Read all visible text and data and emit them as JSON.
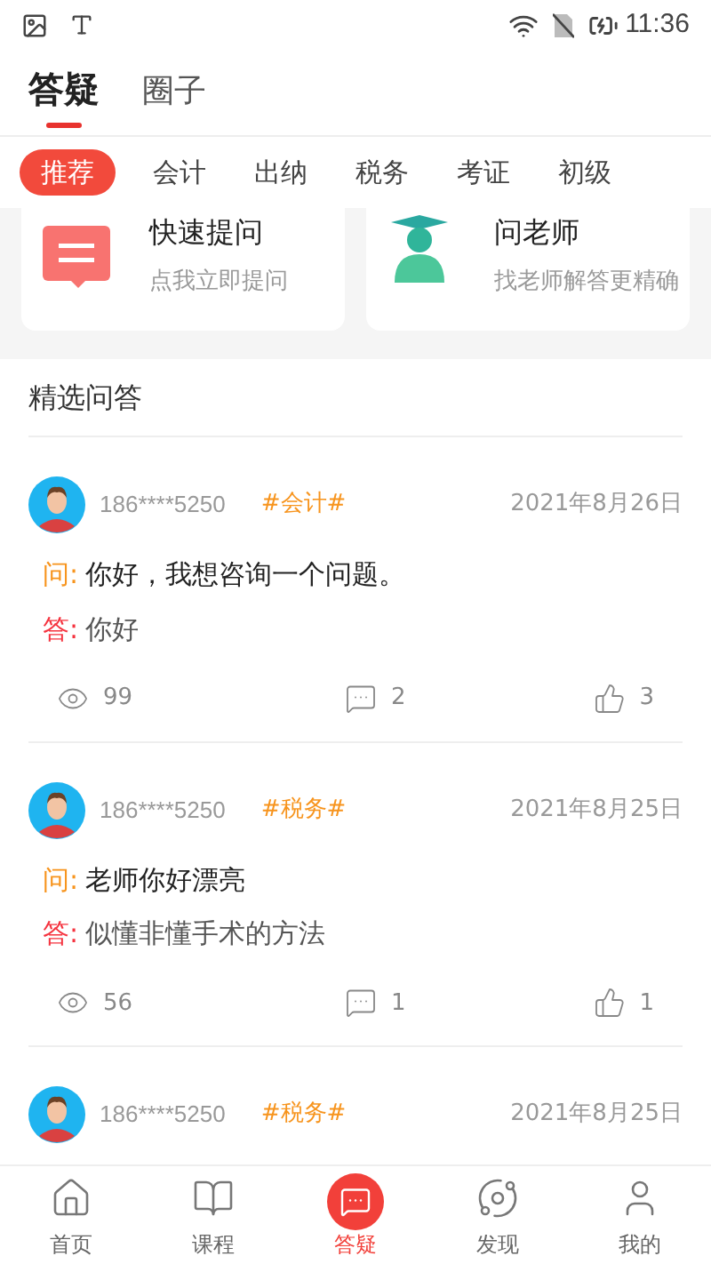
{
  "status_bar": {
    "time": "11:36"
  },
  "header_tabs": [
    {
      "label": "答疑",
      "selected": true
    },
    {
      "label": "圈子",
      "selected": false
    }
  ],
  "categories": [
    {
      "label": "推荐",
      "selected": true
    },
    {
      "label": "会计",
      "selected": false
    },
    {
      "label": "出纳",
      "selected": false
    },
    {
      "label": "税务",
      "selected": false
    },
    {
      "label": "考证",
      "selected": false
    },
    {
      "label": "初级",
      "selected": false
    }
  ],
  "cards": [
    {
      "kind": "ask",
      "title": "快速提问",
      "subtitle": "点我立即提问"
    },
    {
      "kind": "teacher",
      "title": "问老师",
      "subtitle": "找老师解答更精确"
    }
  ],
  "section_title": "精选问答",
  "questions": [
    {
      "user": "186****5250",
      "tag": "#会计#",
      "date": "2021年8月26日",
      "q_label": "问:",
      "question": "你好，我想咨询一个问题。",
      "a_label": "答:",
      "answer": "你好",
      "views": "99",
      "comments": "2",
      "likes": "3"
    },
    {
      "user": "186****5250",
      "tag": "#税务#",
      "date": "2021年8月25日",
      "q_label": "问:",
      "question": "老师你好漂亮",
      "a_label": "答:",
      "answer": "似懂非懂手术的方法",
      "views": "56",
      "comments": "1",
      "likes": "1"
    },
    {
      "user": "186****5250",
      "tag": "#税务#",
      "date": "2021年8月25日"
    }
  ],
  "nav": [
    {
      "label": "首页",
      "kind": "home",
      "selected": false
    },
    {
      "label": "课程",
      "kind": "book",
      "selected": false
    },
    {
      "label": "答疑",
      "kind": "chat",
      "selected": true
    },
    {
      "label": "发现",
      "kind": "planet",
      "selected": false
    },
    {
      "label": "我的",
      "kind": "user",
      "selected": false
    }
  ]
}
